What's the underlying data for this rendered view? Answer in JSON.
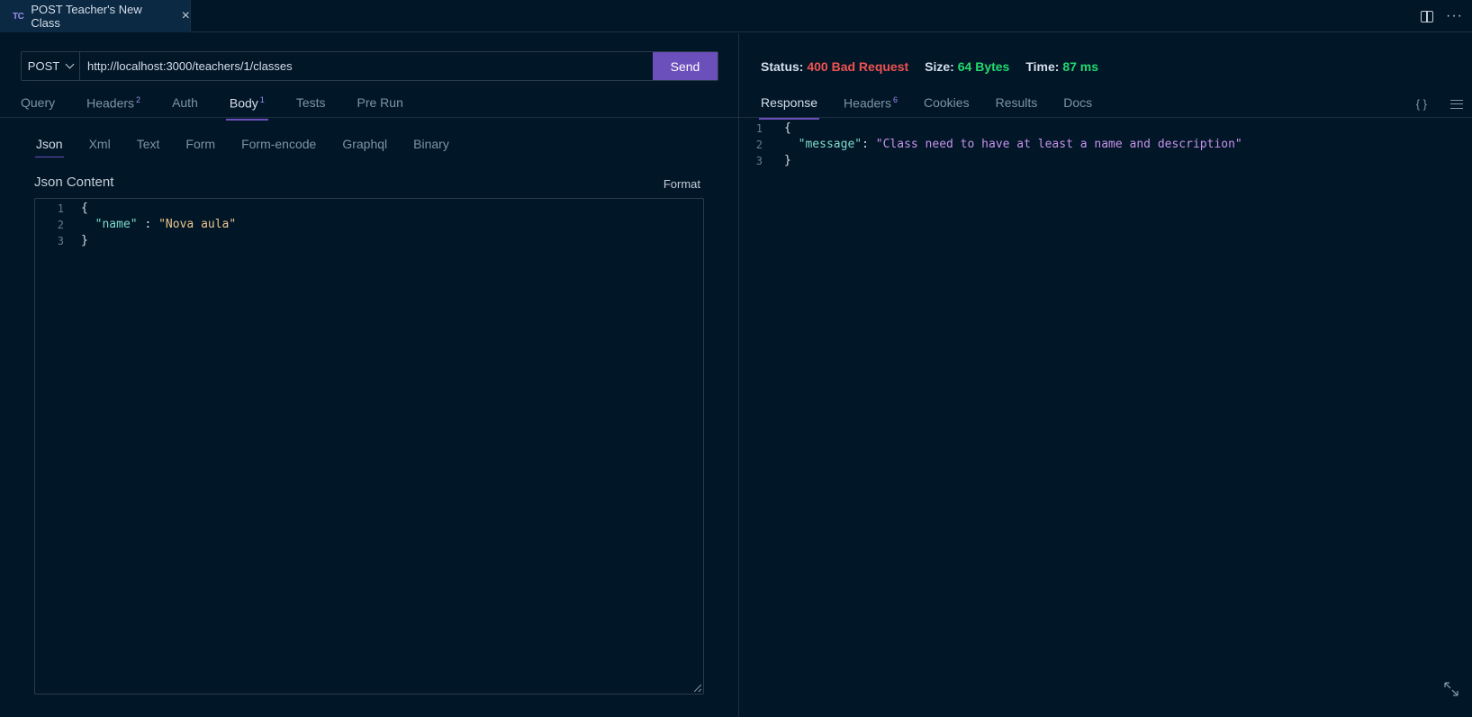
{
  "tab": {
    "badge": "TC",
    "title": "POST Teacher's New Class",
    "close_glyph": "×"
  },
  "request": {
    "method": "POST",
    "url": "http://localhost:3000/teachers/1/classes",
    "send_label": "Send",
    "tabs": [
      {
        "label": "Query",
        "count": ""
      },
      {
        "label": "Headers",
        "count": "2"
      },
      {
        "label": "Auth",
        "count": ""
      },
      {
        "label": "Body",
        "count": "1"
      },
      {
        "label": "Tests",
        "count": ""
      },
      {
        "label": "Pre Run",
        "count": ""
      }
    ],
    "active_tab": "Body",
    "body_tabs": [
      "Json",
      "Xml",
      "Text",
      "Form",
      "Form-encode",
      "Graphql",
      "Binary"
    ],
    "active_body_tab": "Json",
    "content_label": "Json Content",
    "format_label": "Format",
    "body_lines": [
      {
        "n": "1",
        "text": "{"
      },
      {
        "n": "2",
        "key": "\"name\"",
        "sep": " : ",
        "value": "\"Nova aula\""
      },
      {
        "n": "3",
        "text": "}"
      }
    ]
  },
  "response": {
    "status_label": "Status:",
    "status_value": "400 Bad Request",
    "size_label": "Size:",
    "size_value": "64 Bytes",
    "time_label": "Time:",
    "time_value": "87 ms",
    "tabs": [
      {
        "label": "Response",
        "count": ""
      },
      {
        "label": "Headers",
        "count": "6"
      },
      {
        "label": "Cookies",
        "count": ""
      },
      {
        "label": "Results",
        "count": ""
      },
      {
        "label": "Docs",
        "count": ""
      }
    ],
    "active_tab": "Response",
    "braces_icon_label": "{ }",
    "body_lines": [
      {
        "n": "1",
        "text": "{"
      },
      {
        "n": "2",
        "key": "\"message\"",
        "sep": ": ",
        "value": "\"Class need to have at least a name and description\""
      },
      {
        "n": "3",
        "text": "}"
      }
    ]
  },
  "colors": {
    "background": "#011627",
    "accent": "#6b4fbb",
    "status_error": "#ef5350",
    "status_ok": "#22da6e"
  },
  "icons": [
    "split-editor-icon",
    "more-actions-icon",
    "braces-icon",
    "word-wrap-icon",
    "expand-icon",
    "chevron-down-icon",
    "close-icon"
  ]
}
